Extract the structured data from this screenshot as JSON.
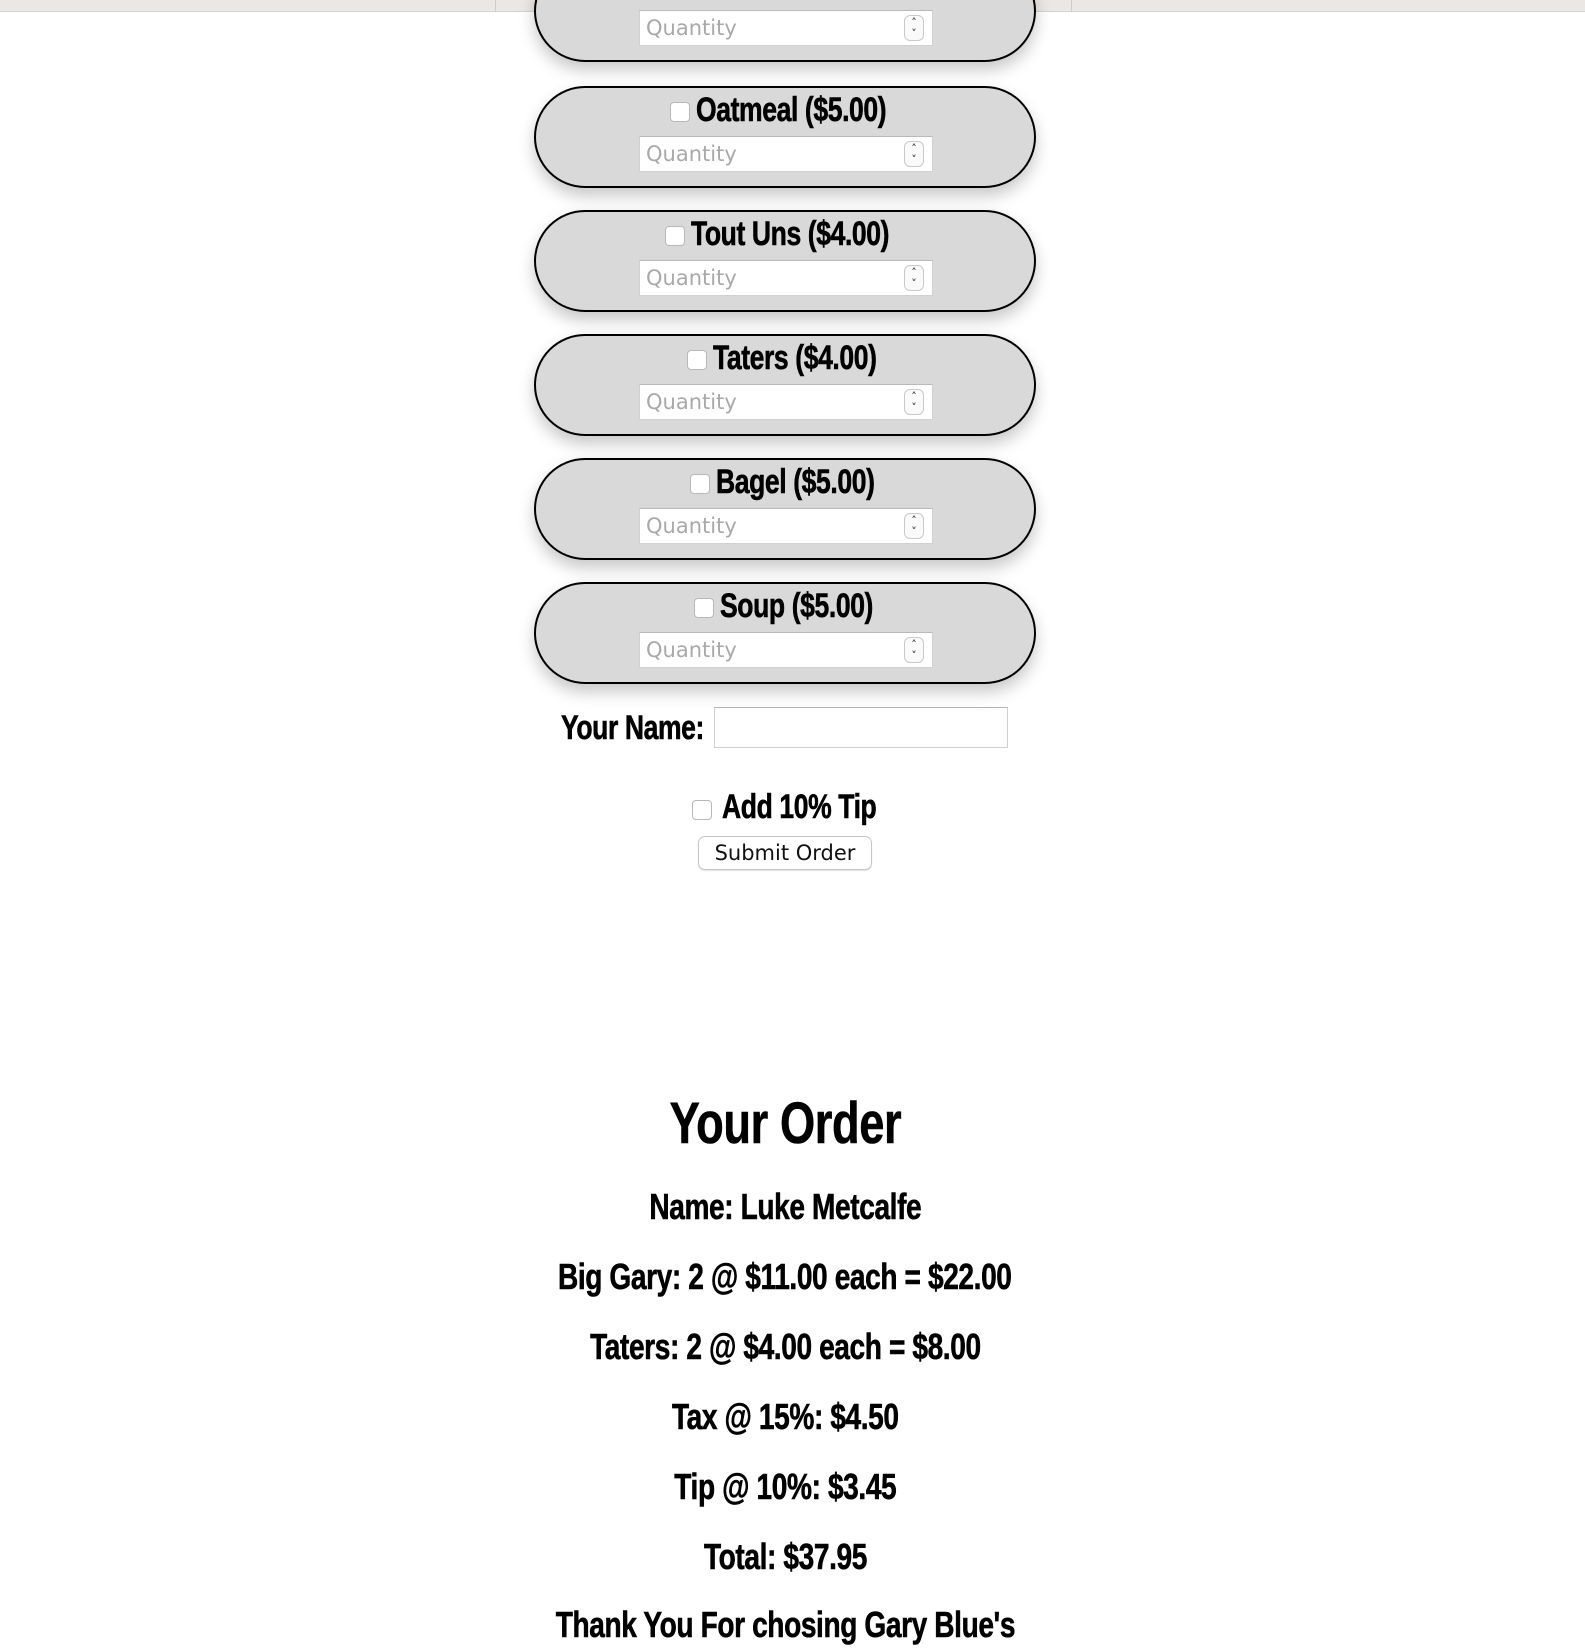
{
  "menu_items": [
    {
      "label": "",
      "placeholder": "Quantity"
    },
    {
      "label": "Oatmeal ($5.00)",
      "placeholder": "Quantity"
    },
    {
      "label": "Tout Uns ($4.00)",
      "placeholder": "Quantity"
    },
    {
      "label": "Taters ($4.00)",
      "placeholder": "Quantity"
    },
    {
      "label": "Bagel ($5.00)",
      "placeholder": "Quantity"
    },
    {
      "label": "Soup ($5.00)",
      "placeholder": "Quantity"
    }
  ],
  "form": {
    "name_label": "Your Name:",
    "name_value": "",
    "tip_label": "Add 10% Tip",
    "submit_label": "Submit Order"
  },
  "order": {
    "title": "Your Order",
    "name_line": "Name: Luke Metcalfe",
    "items": [
      "Big Gary: 2 @ $11.00 each = $22.00",
      "Taters: 2 @ $4.00 each = $8.00"
    ],
    "tax_line": "Tax @ 15%: $4.50",
    "tip_line": "Tip @ 10%: $3.45",
    "total_line": "Total: $37.95",
    "thanks_line": "Thank You For chosing Gary Blue's"
  },
  "colors": {
    "pill_bg": "#d9d9d9",
    "topbar_bg": "#ebe7e5"
  }
}
